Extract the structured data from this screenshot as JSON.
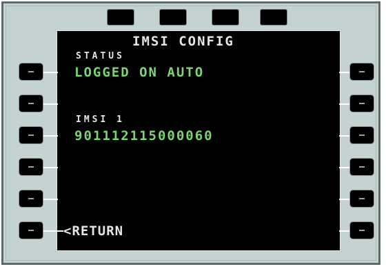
{
  "page": {
    "title": "IMSI CONFIG"
  },
  "fields": {
    "status_label": "STATUS",
    "status_value": "LOGGED ON AUTO",
    "imsi_label": "IMSI 1",
    "imsi_value": "901112115000060"
  },
  "actions": {
    "return_label": "<RETURN"
  },
  "keys": {
    "blank_label": "-"
  },
  "colors": {
    "bezel": "#c4d2d1",
    "screen": "#000000",
    "text_white": "#e6e6e6",
    "text_green": "#7ad66f"
  }
}
